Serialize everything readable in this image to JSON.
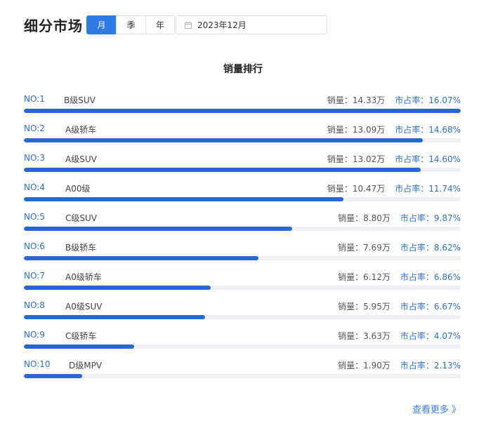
{
  "header": {
    "title": "细分市场"
  },
  "period_tabs": [
    {
      "label": "月",
      "active": true
    },
    {
      "label": "季",
      "active": false
    },
    {
      "label": "年",
      "active": false
    }
  ],
  "date_picker": {
    "value": "2023年12月",
    "icon": "calendar-icon"
  },
  "section": {
    "title": "销量排行"
  },
  "labels": {
    "sales": "销量：",
    "share": "市占率："
  },
  "rankings": [
    {
      "no": "NO:1",
      "name": "B级SUV",
      "sales": "14.33万",
      "share": "16.07%",
      "level": 1.0
    },
    {
      "no": "NO:2",
      "name": "A级轿车",
      "sales": "13.09万",
      "share": "14.68%",
      "level": 0.913
    },
    {
      "no": "NO:3",
      "name": "A级SUV",
      "sales": "13.02万",
      "share": "14.60%",
      "level": 0.909
    },
    {
      "no": "NO:4",
      "name": "A00级",
      "sales": "10.47万",
      "share": "11.74%",
      "level": 0.731
    },
    {
      "no": "NO:5",
      "name": "C级SUV",
      "sales": "8.80万",
      "share": "9.87%",
      "level": 0.614
    },
    {
      "no": "NO:6",
      "name": "B级轿车",
      "sales": "7.69万",
      "share": "8.62%",
      "level": 0.537
    },
    {
      "no": "NO:7",
      "name": "A0级轿车",
      "sales": "6.12万",
      "share": "6.86%",
      "level": 0.427
    },
    {
      "no": "NO:8",
      "name": "A0级SUV",
      "sales": "5.95万",
      "share": "6.67%",
      "level": 0.415
    },
    {
      "no": "NO:9",
      "name": "C级轿车",
      "sales": "3.63万",
      "share": "4.07%",
      "level": 0.253
    },
    {
      "no": "NO:10",
      "name": "D级MPV",
      "sales": "1.90万",
      "share": "2.13%",
      "level": 0.133
    }
  ],
  "more_link": {
    "label": "查看更多 》"
  },
  "colors": {
    "accent": "#2f7ae5",
    "bar": "#2867d6",
    "track": "#eef0f4"
  }
}
